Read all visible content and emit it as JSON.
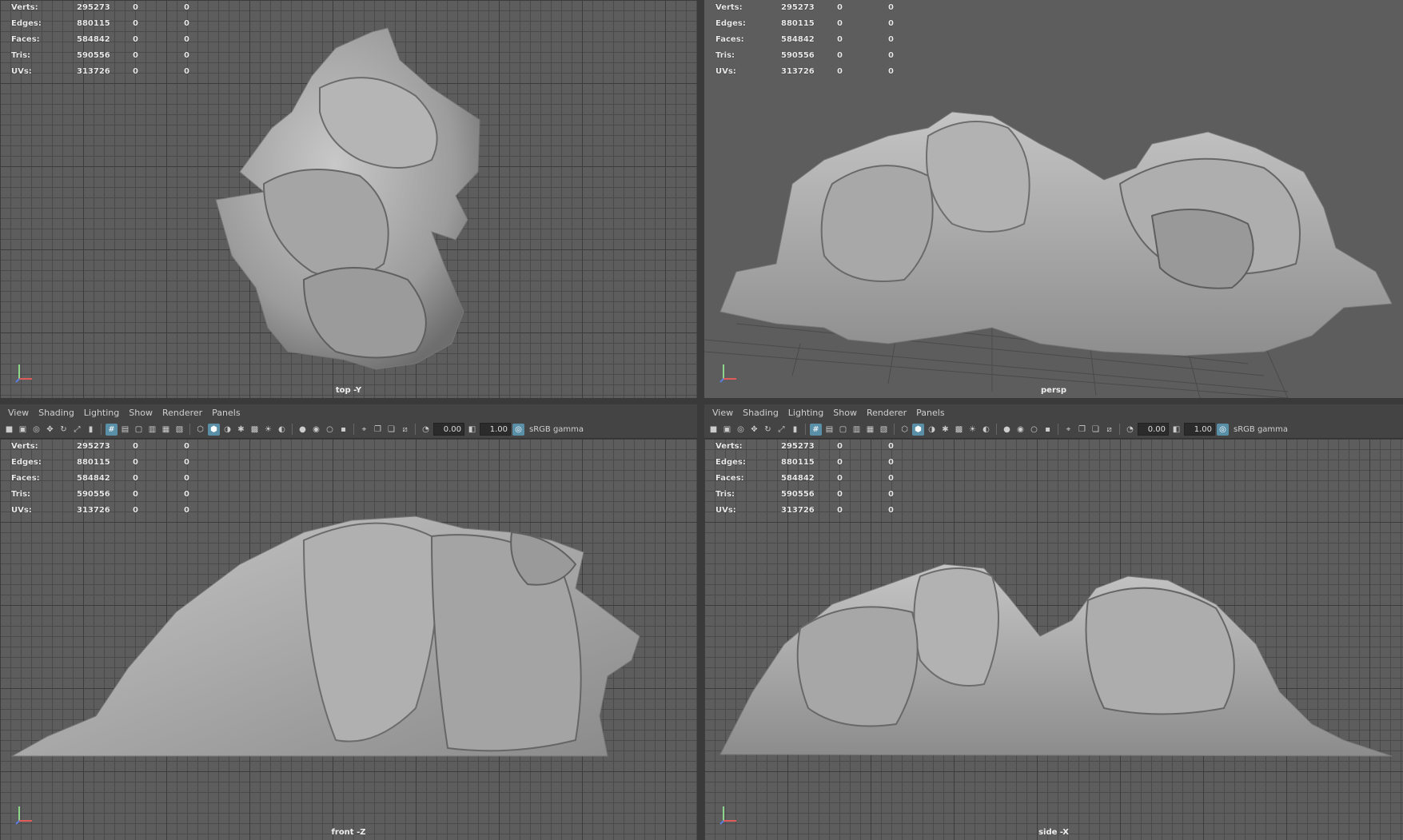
{
  "menu": [
    "View",
    "Shading",
    "Lighting",
    "Show",
    "Renderer",
    "Panels"
  ],
  "toolbar": {
    "exposure": "0.00",
    "gamma_value": "1.00",
    "color_space": "sRGB gamma"
  },
  "hud": [
    {
      "label": "Verts:",
      "value": "295273",
      "a": "0",
      "b": "0"
    },
    {
      "label": "Edges:",
      "value": "880115",
      "a": "0",
      "b": "0"
    },
    {
      "label": "Faces:",
      "value": "584842",
      "a": "0",
      "b": "0"
    },
    {
      "label": "Tris:",
      "value": "590556",
      "a": "0",
      "b": "0"
    },
    {
      "label": "UVs:",
      "value": "313726",
      "a": "0",
      "b": "0"
    }
  ],
  "viewports": {
    "top": {
      "camera": "top -Y"
    },
    "persp": {
      "camera": "persp"
    },
    "front": {
      "camera": "front -Z"
    },
    "side": {
      "camera": "side -X"
    }
  },
  "colors": {
    "viewport_bg": "#5d5d5d",
    "rock": "#a9a9a9",
    "accent": "#5a8fa8"
  },
  "icons": [
    "camera-icon",
    "select-icon",
    "lasso-icon",
    "move-icon",
    "rotate-icon",
    "scale-icon",
    "bookmark-icon",
    "grid-icon",
    "film-gate-icon",
    "wireframe-icon",
    "smooth-shade-icon",
    "textured-icon",
    "lights-icon",
    "shadows-icon",
    "xray-icon",
    "isolate-icon",
    "exposure-icon",
    "gamma-icon",
    "color-management-icon"
  ]
}
